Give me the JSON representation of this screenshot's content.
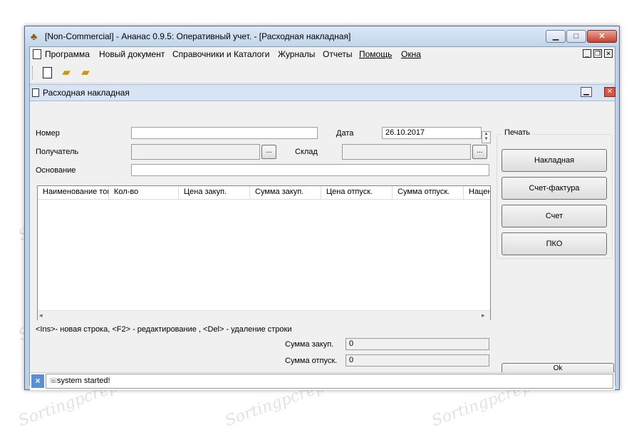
{
  "window": {
    "title": "[Non-Commercial] - Ананас 0.9.5: Оперативный учет. - [Расходная накладная]"
  },
  "menu": {
    "items": [
      "Программа",
      "Новый документ",
      "Справочники и Каталоги",
      "Журналы",
      "Отчеты",
      "Помощь",
      "Окна"
    ]
  },
  "child": {
    "title": "Расходная накладная",
    "form": {
      "number_label": "Номер",
      "number_value": "",
      "date_label": "Дата",
      "date_value": "26.10.2017",
      "recipient_label": "Получатель",
      "recipient_value": "",
      "warehouse_label": "Склад",
      "warehouse_value": "",
      "basis_label": "Основание",
      "basis_value": "",
      "browse_label": "..."
    },
    "grid": {
      "columns": [
        "Наименование товара",
        "Кол-во",
        "Цена закуп.",
        "Сумма закуп.",
        "Цена отпуск.",
        "Сумма отпуск.",
        "Наценка"
      ]
    },
    "hint": "<Ins>- новая строка, <F2> - редактирование , <Del> - удаление строки",
    "totals": {
      "purchase_label": "Сумма закуп.",
      "purchase_value": "0",
      "sale_label": "Сумма отпуск.",
      "sale_value": "0"
    },
    "print": {
      "group_label": "Печать",
      "buttons": [
        "Накладная",
        "Счет-фактура",
        "Счет",
        "ПКО"
      ]
    },
    "ok_label": "Ok"
  },
  "status": {
    "close_glyph": "×",
    "message": "system started!"
  },
  "watermark": "Sortingpcrepair.com",
  "colors": {
    "title_bg": "#c1d5ec",
    "close_red": "#c7402c",
    "status_close": "#5b8fd4"
  }
}
